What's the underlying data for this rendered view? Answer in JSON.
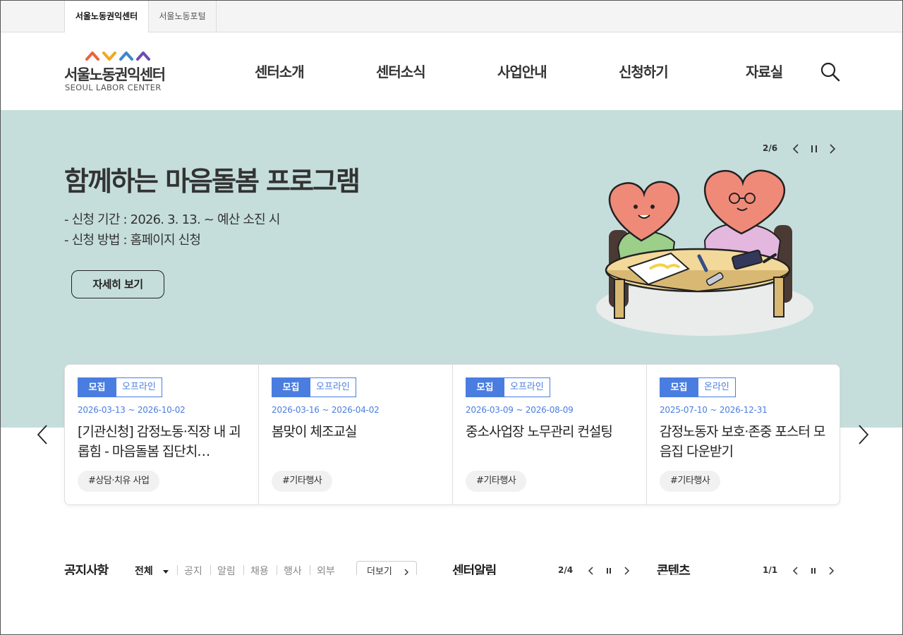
{
  "utility_tabs": [
    {
      "label": "서울노동권익센터"
    },
    {
      "label": "서울노동포털"
    }
  ],
  "logo": {
    "name_ko": "서울노동권익센터",
    "name_en": "SEOUL LABOR CENTER"
  },
  "gnb": [
    {
      "label": "센터소개"
    },
    {
      "label": "센터소식"
    },
    {
      "label": "사업안내"
    },
    {
      "label": "신청하기"
    },
    {
      "label": "자료실"
    }
  ],
  "icons": {
    "search": "search-icon",
    "prev": "chevron-left-icon",
    "next": "chevron-right-icon",
    "pause": "pause-icon",
    "caret": "caret-down-icon"
  },
  "hero": {
    "title": "함께하는 마음돌봄 프로그램",
    "line1": "- 신청 기간 : 2026. 3. 13. ~ 예산 소진 시",
    "line2": "- 신청 방법 : 홈페이지 신청",
    "button": "자세히 보기",
    "counter": "2/6",
    "bg_color": "#c5dedb"
  },
  "cards": [
    {
      "status": "모집",
      "mode": "오프라인",
      "period": "2026-03-13 ~ 2026-10-02",
      "title": "[기관신청] 감정노동·직장 내 괴롭힘 - 마음돌봄 집단치…",
      "tag": "#상담·치유 사업"
    },
    {
      "status": "모집",
      "mode": "오프라인",
      "period": "2026-03-16 ~ 2026-04-02",
      "title": "봄맞이 체조교실",
      "tag": "#기타행사"
    },
    {
      "status": "모집",
      "mode": "오프라인",
      "period": "2026-03-09 ~ 2026-08-09",
      "title": "중소사업장 노무관리 컨설팅",
      "tag": "#기타행사"
    },
    {
      "status": "모집",
      "mode": "온라인",
      "period": "2025-07-10 ~ 2026-12-31",
      "title": "감정노동자 보호·존중 포스터 모음집 다운받기",
      "tag": "#기타행사"
    }
  ],
  "bottom": {
    "notice": {
      "title": "공지사항",
      "selected": "전체",
      "categories": [
        "공지",
        "알림",
        "채용",
        "행사",
        "외부"
      ],
      "more": "더보기"
    },
    "center_news": {
      "title": "센터알림",
      "counter": "2/4"
    },
    "contents": {
      "title": "콘텐츠",
      "counter": "1/1"
    }
  },
  "colors": {
    "accent": "#4a7de0",
    "text": "#222222"
  }
}
